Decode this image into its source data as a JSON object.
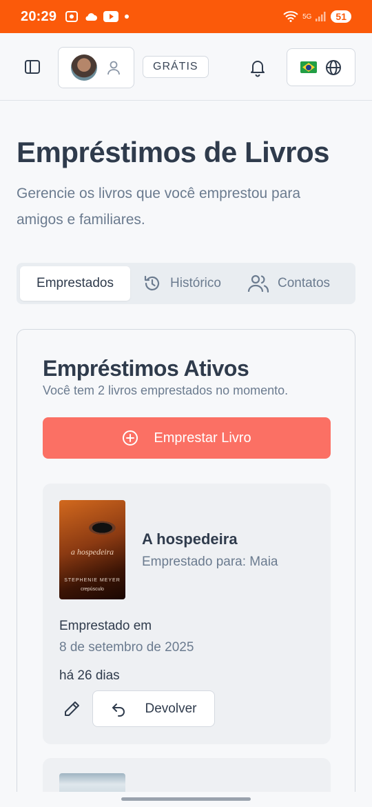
{
  "status_bar": {
    "time": "20:29",
    "network_label": "5G",
    "battery": "51"
  },
  "header": {
    "plan_badge": "GRÁTIS"
  },
  "page": {
    "title": "Empréstimos de Livros",
    "subtitle": "Gerencie os livros que você emprestou para amigos e familiares."
  },
  "tabs": [
    {
      "label": "Emprestados",
      "icon": "none",
      "active": true
    },
    {
      "label": "Histórico",
      "icon": "history-icon",
      "active": false
    },
    {
      "label": "Contatos",
      "icon": "users-icon",
      "active": false
    }
  ],
  "active_loans": {
    "title": "Empréstimos Ativos",
    "description": "Você tem 2 livros emprestados no momento.",
    "lend_button": "Emprestar Livro",
    "items": [
      {
        "book_title": "A hospedeira",
        "borrower": "Emprestado para: Maia",
        "loaned_label": "Emprestado em",
        "loaned_date": "8 de setembro de 2025",
        "loaned_ago": "há 26 dias",
        "return_button": "Devolver",
        "cover": {
          "title": "a hospedeira",
          "author": "STEPHENIE MEYER",
          "series": "crepúsculo"
        }
      }
    ]
  },
  "colors": {
    "status_bar": "#fb5a0a",
    "accent_button": "#fb7064",
    "text_primary": "#2f3b4c",
    "text_muted": "#6b7b8f"
  }
}
